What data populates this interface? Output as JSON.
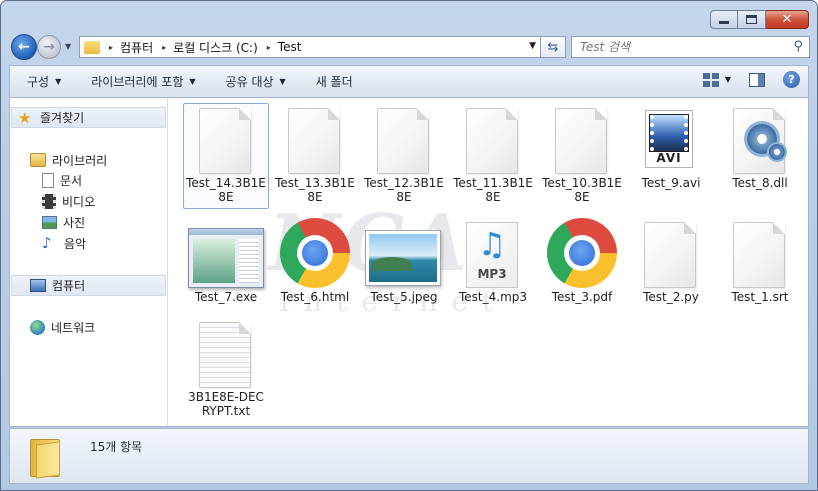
{
  "window": {
    "caption_buttons": {
      "minimize": "",
      "maximize": "",
      "close": "✕"
    }
  },
  "nav": {
    "back_arrow": "←",
    "forward_arrow": "→",
    "history_arrow": "▼",
    "breadcrumb": [
      "컴퓨터",
      "로컬 디스크 (C:)",
      "Test"
    ],
    "breadcrumb_separator": "▸",
    "address_dropdown": "▼",
    "refresh_glyph": "⇆",
    "search_placeholder": "Test 검색",
    "search_glyph": "⚲"
  },
  "toolbar": {
    "organize": "구성",
    "include_library": "라이브러리에 포함",
    "share_with": "공유 대상",
    "new_folder": "새 폴더",
    "dropdown_glyph": "▼",
    "help_glyph": "?"
  },
  "sidebar": {
    "favorites": "즐겨찾기",
    "libraries": "라이브러리",
    "library_items": [
      "문서",
      "비디오",
      "사진",
      "음악"
    ],
    "computer": "컴퓨터",
    "network": "네트워크",
    "star_glyph": "★",
    "music_glyph": "♪"
  },
  "files": [
    {
      "name": "Test_14.3B1E8E",
      "icon": "blank-file-icon",
      "selected": true
    },
    {
      "name": "Test_13.3B1E8E",
      "icon": "blank-file-icon"
    },
    {
      "name": "Test_12.3B1E8E",
      "icon": "blank-file-icon"
    },
    {
      "name": "Test_11.3B1E8E",
      "icon": "blank-file-icon"
    },
    {
      "name": "Test_10.3B1E8E",
      "icon": "blank-file-icon"
    },
    {
      "name": "Test_9.avi",
      "icon": "avi-video-icon",
      "label": "AVI"
    },
    {
      "name": "Test_8.dll",
      "icon": "dll-gear-icon"
    },
    {
      "name": "Test_7.exe",
      "icon": "exe-window-icon"
    },
    {
      "name": "Test_6.html",
      "icon": "chrome-icon"
    },
    {
      "name": "Test_5.jpeg",
      "icon": "landscape-image-icon"
    },
    {
      "name": "Test_4.mp3",
      "icon": "mp3-music-icon",
      "label": "MP3",
      "glyph": "♫"
    },
    {
      "name": "Test_3.pdf",
      "icon": "chrome-icon"
    },
    {
      "name": "Test_2.py",
      "icon": "blank-file-icon"
    },
    {
      "name": "Test_1.srt",
      "icon": "blank-file-icon"
    },
    {
      "name": "3B1E8E-DECRYPT.txt",
      "icon": "text-document-icon"
    }
  ],
  "watermark": {
    "big": "NCA",
    "small": "Internet"
  },
  "status": {
    "item_count": "15개 항목"
  },
  "colors": {
    "window_frame": "#b9cde6",
    "selection_border": "#84acdd",
    "close_button": "#c0391f"
  }
}
